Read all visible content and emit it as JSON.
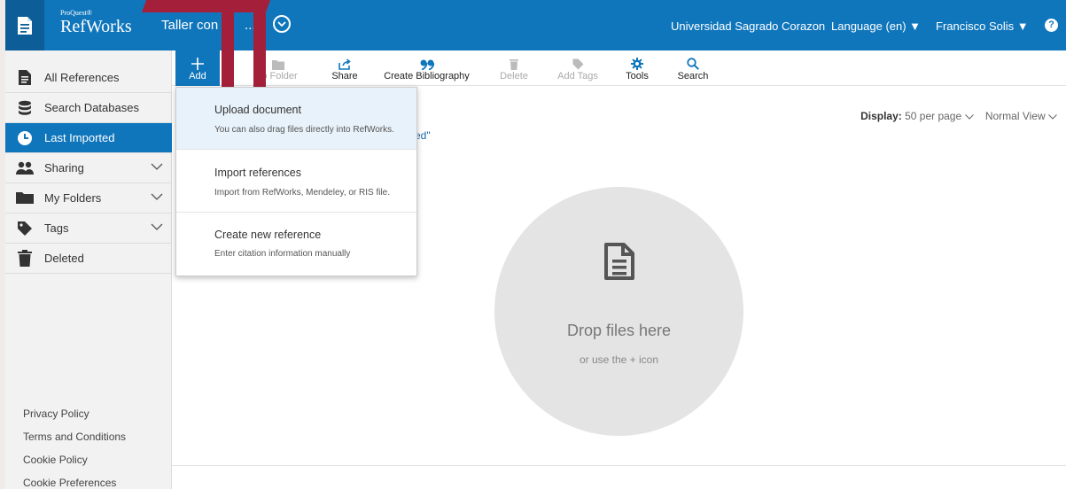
{
  "header": {
    "brand_small": "ProQuest®",
    "brand_name": "RefWorks",
    "project_title": "Taller con",
    "project_ellipsis": "...",
    "institution": "Universidad Sagrado Corazon",
    "language": "Language (en) ▼",
    "user": "Francisco Solis ▼",
    "help": "?"
  },
  "sidebar": {
    "items": [
      {
        "label": "All References",
        "icon": "document-icon"
      },
      {
        "label": "Search Databases",
        "icon": "database-icon"
      },
      {
        "label": "Last Imported",
        "icon": "clock-icon"
      },
      {
        "label": "Sharing",
        "icon": "users-icon"
      },
      {
        "label": "My Folders",
        "icon": "folder-icon"
      },
      {
        "label": "Tags",
        "icon": "tag-icon"
      },
      {
        "label": "Deleted",
        "icon": "trash-icon"
      }
    ],
    "footer": [
      "Privacy Policy",
      "Terms and Conditions",
      "Cookie Policy",
      "Cookie Preferences"
    ]
  },
  "toolbar": {
    "add": "Add",
    "folder": "to Folder",
    "share": "Share",
    "bibliography": "Create Bibliography",
    "delete": "Delete",
    "tags": "Add Tags",
    "tools": "Tools",
    "search": "Search"
  },
  "display": {
    "label": "Display:",
    "per_page": "50 per page",
    "view": "Normal View"
  },
  "fragment_text": "ed\"",
  "dropzone": {
    "title": "Drop files here",
    "subtitle": "or use the + icon"
  },
  "add_menu": [
    {
      "title": "Upload document",
      "subtitle": "You can also drag files directly into RefWorks."
    },
    {
      "title": "Import references",
      "subtitle": "Import from RefWorks, Mendeley, or RIS file."
    },
    {
      "title": "Create new reference",
      "subtitle": "Enter citation information manually"
    }
  ],
  "colors": {
    "header": "#1076bc",
    "active": "#1076bc",
    "overlay_red": "#a4203a"
  }
}
